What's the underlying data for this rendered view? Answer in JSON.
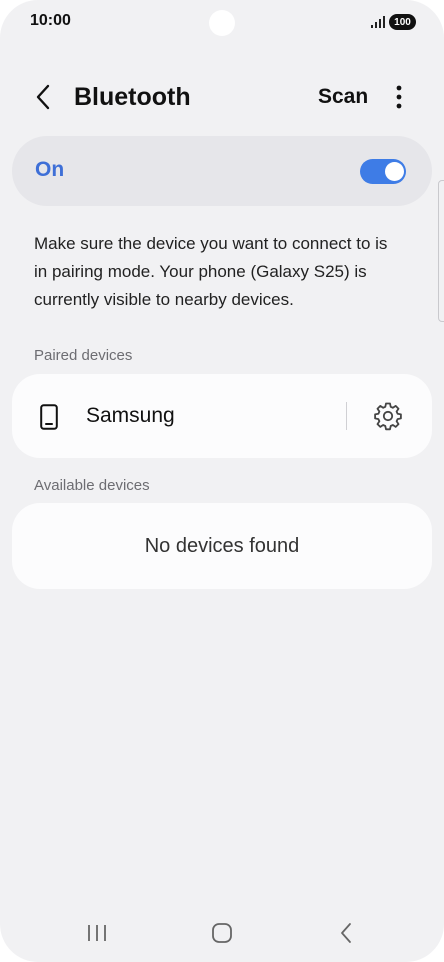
{
  "status_bar": {
    "time": "10:00",
    "battery": "100",
    "signal_icon": "signal-icon"
  },
  "header": {
    "title": "Bluetooth",
    "back_icon": "back-arrow-icon",
    "scan_label": "Scan",
    "more_icon": "more-options-icon"
  },
  "bluetooth_toggle": {
    "label": "On",
    "state": true,
    "accent": "#3e7ce6",
    "label_color": "#3e6fd7"
  },
  "description": "Make sure the device you want to connect to is in pairing mode. Your phone (Galaxy S25) is currently visible to nearby devices.",
  "paired": {
    "section_label": "Paired devices",
    "devices": [
      {
        "name": "Samsung",
        "icon": "phone-icon",
        "settings_icon": "gear-icon"
      }
    ]
  },
  "available": {
    "section_label": "Available devices",
    "empty_text": "No devices found"
  },
  "nav_bar": {
    "recents_icon": "recents-icon",
    "home_icon": "home-icon",
    "back_icon": "nav-back-icon"
  }
}
